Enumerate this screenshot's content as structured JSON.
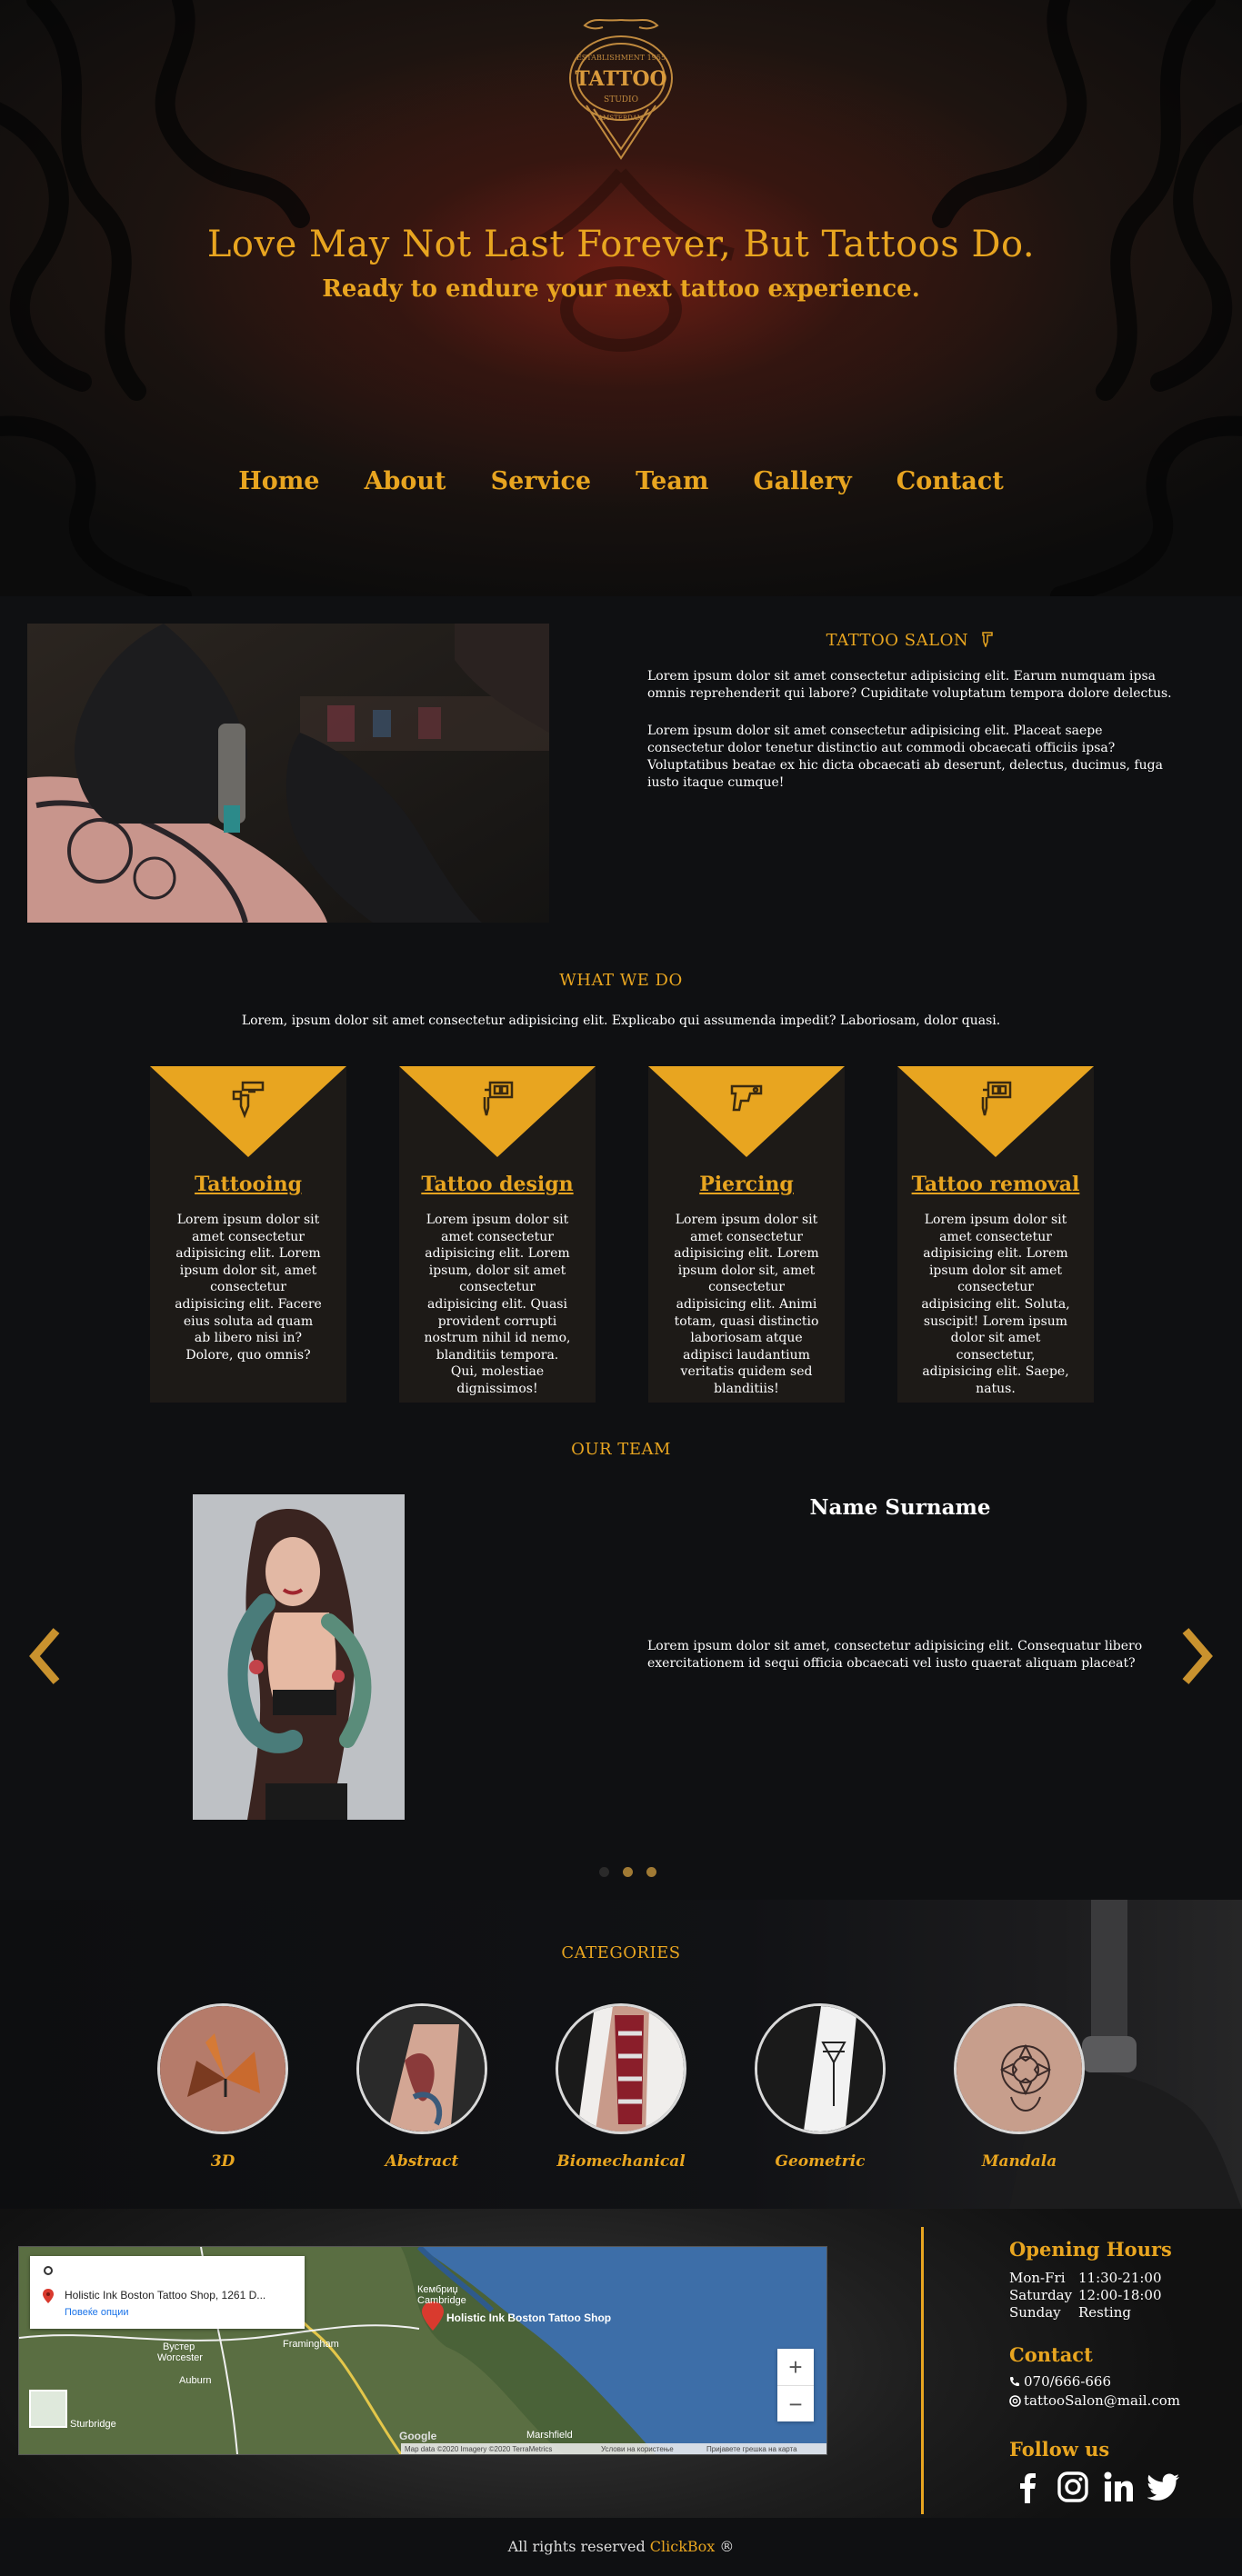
{
  "hero": {
    "logo_text": "TATTOO",
    "logo_top": "ESTABLISHMENT 1955",
    "logo_mid": "STUDIO",
    "logo_bottom": "AMSTERDAM",
    "title": "Love May Not Last Forever, But Tattoos Do.",
    "subtitle": "Ready to endure your next tattoo experience."
  },
  "nav": {
    "items": [
      "Home",
      "About",
      "Service",
      "Team",
      "Gallery",
      "Contact"
    ]
  },
  "about": {
    "title": "TATTOO SALON",
    "title_icon": "tattoo-machine-icon",
    "p1": "Lorem ipsum dolor sit amet consectetur adipisicing elit. Earum numquam ipsa omnis reprehenderit qui labore? Cupiditate voluptatum tempora dolore delectus.",
    "p2": "Lorem ipsum dolor sit amet consectetur adipisicing elit. Placeat saepe consectetur dolor tenetur distinctio aut commodi obcaecati officiis ipsa? Voluptatibus beatae ex hic dicta obcaecati ab deserunt, delectus, ducimus, fuga iusto itaque cumque!"
  },
  "services": {
    "title": "WHAT WE DO",
    "intro": "Lorem, ipsum dolor sit amet consectetur adipisicing elit. Explicabo qui assumenda impedit? Laboriosam, dolor quasi.",
    "cards": [
      {
        "title": "Tattooing",
        "icon": "tattoo-gun-icon",
        "text": "Lorem ipsum dolor sit amet consectetur adipisicing elit. Lorem ipsum dolor sit, amet consectetur adipisicing elit. Facere eius soluta ad quam ab libero nisi in? Dolore, quo omnis?"
      },
      {
        "title": "Tattoo design",
        "icon": "tattoo-machine-icon",
        "text": "Lorem ipsum dolor sit amet consectetur adipisicing elit. Lorem ipsum, dolor sit amet consectetur adipisicing elit. Quasi provident corrupti nostrum nihil id nemo, blanditiis tempora. Qui, molestiae dignissimos!"
      },
      {
        "title": "Piercing",
        "icon": "piercing-gun-icon",
        "text": "Lorem ipsum dolor sit amet consectetur adipisicing elit. Lorem ipsum dolor sit, amet consectetur adipisicing elit. Animi totam, quasi distinctio laboriosam atque adipisci laudantium veritatis quidem sed blanditiis!"
      },
      {
        "title": "Tattoo removal",
        "icon": "tattoo-machine-icon",
        "text": "Lorem ipsum dolor sit amet consectetur adipisicing elit. Lorem ipsum dolor sit amet consectetur adipisicing elit. Soluta, suscipit! Lorem ipsum dolor sit amet consectetur, adipisicing elit. Saepe, natus."
      }
    ]
  },
  "team": {
    "title": "OUR TEAM",
    "name": "Name Surname",
    "bio": "Lorem ipsum dolor sit amet, consectetur adipisicing elit. Consequatur libero exercitationem id sequi officia obcaecati vel iusto quaerat aliquam placeat?",
    "slides": 3,
    "active_slide": 1
  },
  "categories": {
    "title": "CATEGORIES",
    "items": [
      "3D",
      "Abstract",
      "Biomechanical",
      "Geometric",
      "Mandala"
    ]
  },
  "map": {
    "place_name": "Holistic Ink Boston Tattoo Shop, 1261 D...",
    "more_options": "Повеќе опции",
    "pin_label": "Holistic Ink Boston Tattoo Shop",
    "city_labels": [
      "Кембриџ",
      "Cambridge",
      "Framingham",
      "Вустер",
      "Worcester",
      "Auburn",
      "Sturbridge",
      "Marshfield"
    ],
    "zoom_in": "+",
    "zoom_out": "−",
    "attribution": "Map data ©2020 Imagery ©2020 TerraMetrics",
    "terms": "Услови на користење",
    "report": "Пријавете грешка на карта",
    "google": "Google"
  },
  "footer": {
    "hours_title": "Opening Hours",
    "hours": [
      {
        "day": "Mon-Fri",
        "time": "11:30-21:00"
      },
      {
        "day": "Saturday",
        "time": "12:00-18:00"
      },
      {
        "day": "Sunday",
        "time": "Resting"
      }
    ],
    "contact_title": "Contact",
    "phone": "070/666-666",
    "email": "tattooSalon@mail.com",
    "follow_title": "Follow us",
    "social": [
      "facebook-icon",
      "instagram-icon",
      "linkedin-icon",
      "twitter-icon"
    ],
    "copyright_prefix": "All rights reserved",
    "copyright_brand": "ClickBox",
    "copyright_symbol": "®"
  },
  "colors": {
    "accent": "#e8a520",
    "background": "#0f1012",
    "card": "#1d1a17"
  }
}
